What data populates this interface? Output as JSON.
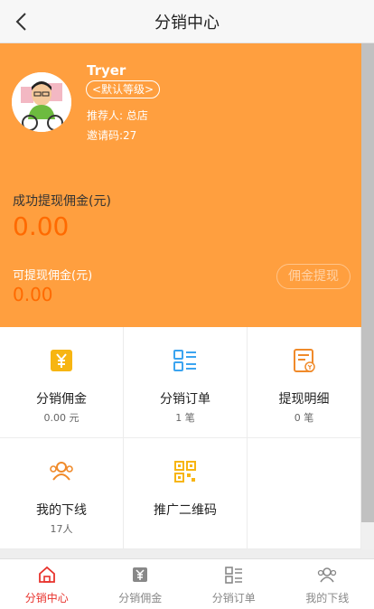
{
  "nav": {
    "title": "分销中心"
  },
  "profile": {
    "name": "Tryer",
    "level": "<默认等级>",
    "referrer": "推荐人: 总店",
    "invite_code": "邀请码:27"
  },
  "commission": {
    "success_label": "成功提现佣金(元)",
    "success_value": "0.00",
    "available_label": "可提现佣金(元)",
    "available_value": "0.00",
    "withdraw_button": "佣金提现"
  },
  "grid": [
    {
      "label": "分销佣金",
      "sub": "0.00 元",
      "icon": "yen-icon"
    },
    {
      "label": "分销订单",
      "sub": "1 笔",
      "icon": "order-list-icon"
    },
    {
      "label": "提现明细",
      "sub": "0 笔",
      "icon": "withdraw-detail-icon"
    },
    {
      "label": "我的下线",
      "sub": "17人",
      "icon": "team-icon"
    },
    {
      "label": "推广二维码",
      "sub": "",
      "icon": "qrcode-icon"
    }
  ],
  "tabs": [
    {
      "label": "分销中心",
      "icon": "home-icon",
      "active": true
    },
    {
      "label": "分销佣金",
      "icon": "yen-icon",
      "active": false
    },
    {
      "label": "分销订单",
      "icon": "order-list-icon",
      "active": false
    },
    {
      "label": "我的下线",
      "icon": "team-icon",
      "active": false
    }
  ],
  "colors": {
    "hero_bg": "#ff9f3f",
    "accent_orange": "#ff6a00",
    "icon_yellow": "#f7b512",
    "icon_blue": "#3ba4f0",
    "active_tab": "#e8322c"
  }
}
